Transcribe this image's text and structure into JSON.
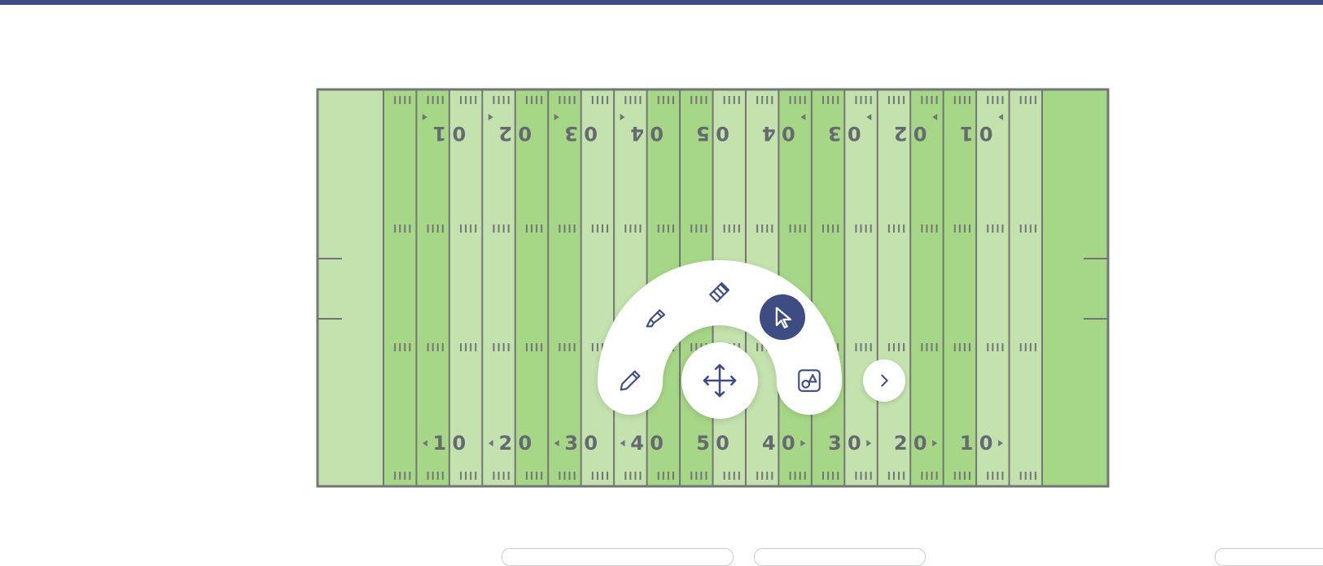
{
  "app": {
    "accent_color": "#3d4c83",
    "field_light_color": "#c3e2ad",
    "field_dark_color": "#a6d786",
    "line_color": "#737577"
  },
  "field": {
    "top_numbers": [
      "1",
      "0",
      "2",
      "0",
      "3",
      "0",
      "4",
      "0",
      "5",
      "0",
      "4",
      "0",
      "3",
      "0",
      "2",
      "0",
      "1",
      "0"
    ],
    "bottom_numbers": [
      "1",
      "0",
      "2",
      "0",
      "3",
      "0",
      "4",
      "0",
      "5",
      "0",
      "4",
      "0",
      "3",
      "0",
      "2",
      "0",
      "1",
      "0"
    ]
  },
  "toolbar": {
    "tools": [
      {
        "id": "pencil",
        "icon": "pencil-icon",
        "active": false
      },
      {
        "id": "highlighter",
        "icon": "highlighter-icon",
        "active": false
      },
      {
        "id": "eraser",
        "icon": "eraser-icon",
        "active": false
      },
      {
        "id": "select",
        "icon": "cursor-icon",
        "active": true
      },
      {
        "id": "shapes",
        "icon": "shapes-icon",
        "active": false
      }
    ],
    "move_icon": "move-icon",
    "next_icon": "chevron-right-icon"
  }
}
